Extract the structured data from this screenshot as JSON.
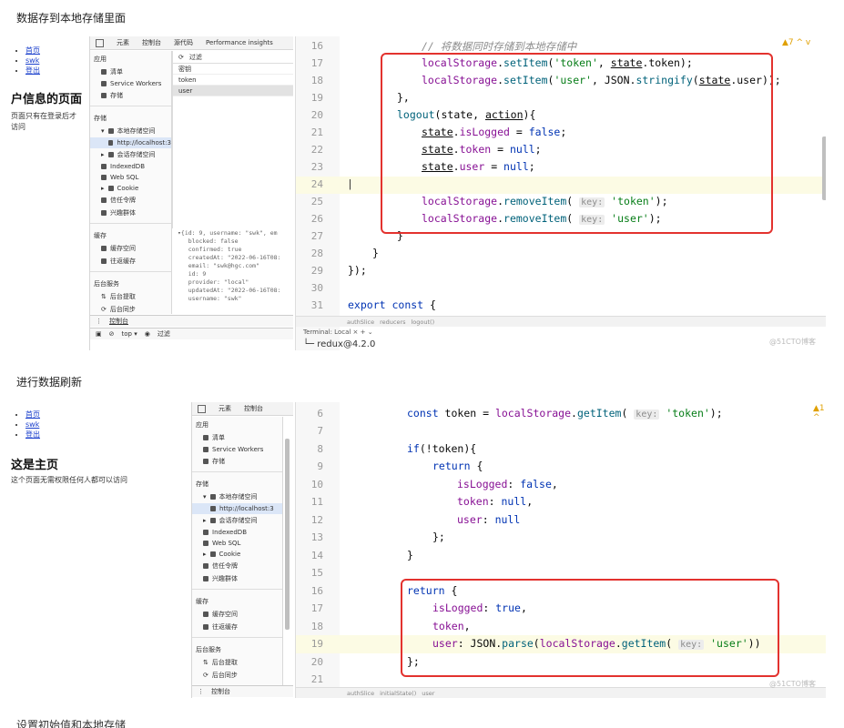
{
  "captions": {
    "first": "数据存到本地存储里面",
    "second": "进行数据刷新",
    "third": "设置初始值和本地存储"
  },
  "shot1": {
    "page": {
      "links": [
        "首页",
        "swk",
        "登出"
      ],
      "heading": "户信息的页面",
      "text": "页面只有在登录后才\n访问"
    },
    "devtools": {
      "tabs": [
        "元素",
        "控制台",
        "源代码",
        "Performance insights"
      ],
      "filter_placeholder": "过滤",
      "sections": {
        "app": "应用",
        "storage": "存储",
        "cache": "缓存",
        "bg": "后台服务"
      },
      "app_items": [
        "清单",
        "Service Workers",
        "存储"
      ],
      "storage_items": [
        "本地存储空间",
        "http://localhost:3",
        "会话存储空间",
        "IndexedDB",
        "Web SQL",
        "Cookie",
        "信任令牌",
        "兴趣群体"
      ],
      "cache_items": [
        "缓存空间",
        "往返缓存"
      ],
      "bg_items": [
        "后台提取",
        "后台同步"
      ],
      "table_header": "密钥",
      "table_rows": [
        "token",
        "user"
      ],
      "json_preview": "▾{id: 9, username: \"swk\", em\n   blocked: false\n   confirmed: true\n   createdAt: \"2022-06-16T08:\n   email: \"swk@hgc.com\"\n   id: 9\n   provider: \"local\"\n   updatedAt: \"2022-06-16T08:\n   username: \"swk\"",
      "console_tab": "控制台",
      "console_bar": [
        "top ▾",
        "过滤"
      ]
    },
    "editor": {
      "line_numbers": [
        "16",
        "17",
        "18",
        "19",
        "20",
        "21",
        "22",
        "23",
        "24",
        "25",
        "26",
        "27",
        "28",
        "29",
        "30",
        "31"
      ],
      "comment": "// 将数据同时存储到本地存储中",
      "line17": [
        "localStorage",
        ".",
        "setItem",
        "(",
        "'token'",
        ", ",
        "state",
        ".token);"
      ],
      "line18": [
        "localStorage",
        ".",
        "setItem",
        "(",
        "'user'",
        ", JSON.",
        "stringify",
        "(",
        "state",
        ".user));"
      ],
      "line19": "},",
      "line20": [
        "logout",
        "(",
        "state",
        ", ",
        "action",
        "){"
      ],
      "line21": [
        "state",
        ".",
        "isLogged",
        " = ",
        "false",
        ";"
      ],
      "line22": [
        "state",
        ".",
        "token",
        " = ",
        "null",
        ";"
      ],
      "line23": [
        "state",
        ".",
        "user",
        " = ",
        "null",
        ";"
      ],
      "line25": [
        "localStorage",
        ".",
        "removeItem",
        "( ",
        "key:",
        " ",
        "'token'",
        ");"
      ],
      "line26": [
        "localStorage",
        ".",
        "removeItem",
        "( ",
        "key:",
        " ",
        "'user'",
        ");"
      ],
      "line27": "}",
      "line28": "}",
      "line29": "});",
      "line31": [
        "export",
        " ",
        "const",
        " {"
      ],
      "breadcrumbs": [
        "authSlice",
        "reducers",
        "logout()"
      ],
      "terminal_tabs": "Terminal:  Local  ×  +  ⌄",
      "terminal_line": "└─ redux@4.2.0",
      "watermark": "@51CTO博客",
      "warn_badge": "▲7 ^ v"
    }
  },
  "shot2": {
    "page": {
      "links": [
        "首页",
        "swk",
        "登出"
      ],
      "heading": "这是主页",
      "text": "这个页面无需权限任何人都可以访问"
    },
    "devtools": {
      "tabs": [
        "元素",
        "控制台"
      ],
      "sections": {
        "app": "应用",
        "storage": "存储",
        "cache": "缓存",
        "bg": "后台服务"
      },
      "app_items": [
        "清单",
        "Service Workers",
        "存储"
      ],
      "storage_items": [
        "本地存储空间",
        "http://localhost:3",
        "会话存储空间",
        "IndexedDB",
        "Web SQL",
        "Cookie",
        "信任令牌",
        "兴趣群体"
      ],
      "cache_items": [
        "缓存空间",
        "往返缓存"
      ],
      "bg_items": [
        "后台提取",
        "后台同步"
      ],
      "console_tab": "控制台"
    },
    "editor": {
      "line_numbers": [
        "6",
        "7",
        "8",
        "9",
        "10",
        "11",
        "12",
        "13",
        "14",
        "15",
        "16",
        "17",
        "18",
        "19",
        "20",
        "21"
      ],
      "line6": [
        "const",
        " token = ",
        "localStorage",
        ".",
        "getItem",
        "( ",
        "key:",
        " ",
        "'token'",
        ");"
      ],
      "line8": [
        "if",
        "(!token){"
      ],
      "line9": [
        "return",
        " {"
      ],
      "line10": [
        "isLogged",
        ": ",
        "false",
        ","
      ],
      "line11": [
        "token",
        ": ",
        "null",
        ","
      ],
      "line12": [
        "user",
        ": ",
        "null"
      ],
      "line13": "};",
      "line14": "}",
      "line16": [
        "return",
        " {"
      ],
      "line17": [
        "isLogged",
        ": ",
        "true",
        ","
      ],
      "line18": [
        "token",
        ","
      ],
      "line19": [
        "user",
        ": JSON.",
        "parse",
        "(",
        "localStorage",
        ".",
        "getItem",
        "( ",
        "key:",
        " ",
        "'user'",
        "))"
      ],
      "line20": "};",
      "breadcrumbs": [
        "authSlice",
        "initialState()",
        "user"
      ],
      "watermark": "@51CTO博客",
      "warn_badge": "▲1 ^"
    }
  }
}
